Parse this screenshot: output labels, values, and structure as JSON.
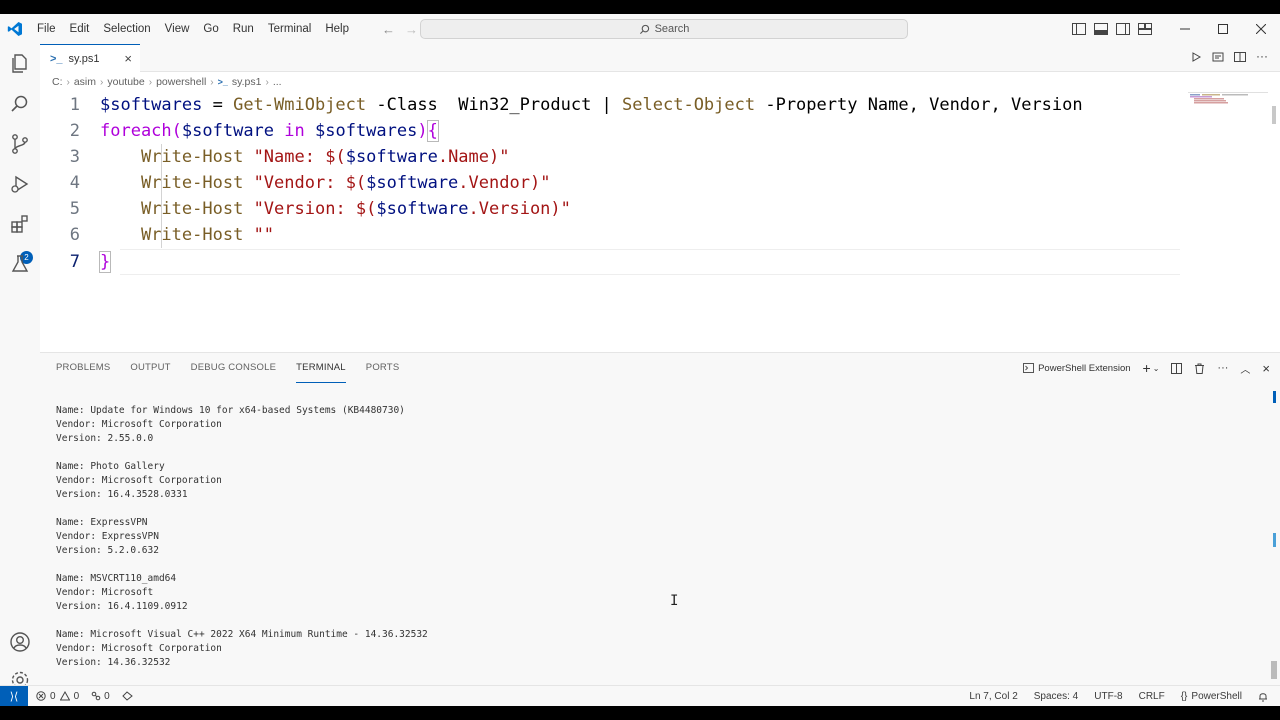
{
  "menu": [
    "File",
    "Edit",
    "Selection",
    "View",
    "Go",
    "Run",
    "Terminal",
    "Help"
  ],
  "search": {
    "label": "Search"
  },
  "tab": {
    "filename": "sy.ps1"
  },
  "breadcrumb": [
    "C:",
    "asim",
    "youtube",
    "powershell",
    "sy.ps1",
    "..."
  ],
  "editor": {
    "line_numbers": [
      "1",
      "2",
      "3",
      "4",
      "5",
      "6",
      "7"
    ],
    "line1": {
      "var": "$softwares",
      "eq": " = ",
      "cmd1": "Get-WmiObject",
      "p1": " -Class  Win32_Product ",
      "pipe": "|",
      "sp": " ",
      "cmd2": "Select-Object",
      "p2": " -Property Name, Vendor, Version"
    },
    "line2": {
      "kw": "foreach",
      "open": "(",
      "var1": "$software",
      "in": " in ",
      "var2": "$softwares",
      "close": ")",
      "brace": "{"
    },
    "line3": {
      "indent": "    ",
      "cmd": "Write-Host",
      "sp": " ",
      "s1": "\"Name: ",
      "d": "$(",
      "v": "$software",
      "prop": ".Name",
      "c": ")",
      "q": "\""
    },
    "line4": {
      "indent": "    ",
      "cmd": "Write-Host",
      "sp": " ",
      "s1": "\"Vendor: ",
      "d": "$(",
      "v": "$software",
      "prop": ".Vendor",
      "c": ")",
      "q": "\""
    },
    "line5": {
      "indent": "    ",
      "cmd": "Write-Host",
      "sp": " ",
      "s1": "\"Version: ",
      "d": "$(",
      "v": "$software",
      "prop": ".Version",
      "c": ")",
      "q": "\""
    },
    "line6": {
      "indent": "    ",
      "cmd": "Write-Host",
      "sp": " ",
      "s": "\"\""
    },
    "line7": {
      "brace": "}"
    }
  },
  "panel": {
    "tabs": [
      "PROBLEMS",
      "OUTPUT",
      "DEBUG CONSOLE",
      "TERMINAL",
      "PORTS"
    ],
    "active_tab": "TERMINAL",
    "terminal_name": "PowerShell Extension"
  },
  "terminal_entries": [
    {
      "name": "Name: Update for Windows 10 for x64-based Systems (KB4480730)",
      "vendor": "Vendor: Microsoft Corporation",
      "version": "Version: 2.55.0.0"
    },
    {
      "name": "Name: Photo Gallery",
      "vendor": "Vendor: Microsoft Corporation",
      "version": "Version: 16.4.3528.0331"
    },
    {
      "name": "Name: ExpressVPN",
      "vendor": "Vendor: ExpressVPN",
      "version": "Version: 5.2.0.632"
    },
    {
      "name": "Name: MSVCRT110_amd64",
      "vendor": "Vendor: Microsoft",
      "version": "Version: 16.4.1109.0912"
    },
    {
      "name": "Name: Microsoft Visual C++ 2022 X64 Minimum Runtime - 14.36.32532",
      "vendor": "Vendor: Microsoft Corporation",
      "version": "Version: 14.36.32532"
    }
  ],
  "status": {
    "errors": "0",
    "warnings": "0",
    "ports": "0",
    "position": "Ln 7, Col 2",
    "spaces": "Spaces: 4",
    "encoding": "UTF-8",
    "eol": "CRLF",
    "language": "PowerShell"
  },
  "colors": {
    "accent": "#005fb8",
    "background": "#f8f8f8",
    "editor": "#ffffff"
  }
}
